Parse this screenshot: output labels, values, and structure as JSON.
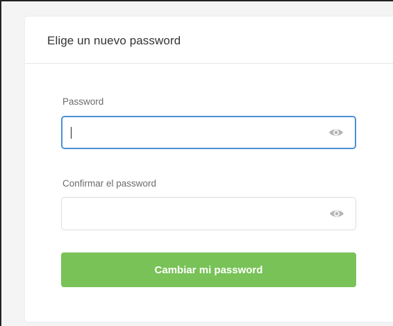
{
  "form": {
    "title": "Elige un nuevo password",
    "password": {
      "label": "Password",
      "value": "",
      "placeholder": ""
    },
    "confirm": {
      "label": "Confirmar el password",
      "value": "",
      "placeholder": ""
    },
    "submit_label": "Cambiar mi password"
  },
  "icons": {
    "toggle_visibility": "eye-icon"
  },
  "colors": {
    "button": "#78c257",
    "focus_border": "#4a8fd6"
  }
}
